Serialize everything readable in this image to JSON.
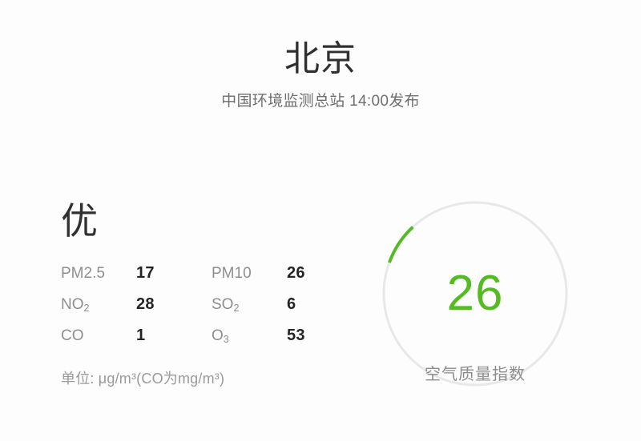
{
  "header": {
    "city": "北京",
    "source": "中国环境监测总站 14:00发布"
  },
  "air_quality": {
    "level_label": "优",
    "aqi_value": "26",
    "aqi_caption": "空气质量指数",
    "accent_color": "#55bb22",
    "track_color": "#e8e8e8"
  },
  "pollutants": {
    "rows": [
      {
        "left": {
          "label": "PM2.5",
          "sub": "",
          "value": "17"
        },
        "right": {
          "label": "PM10",
          "sub": "",
          "value": "26"
        }
      },
      {
        "left": {
          "label": "NO",
          "sub": "2",
          "value": "28"
        },
        "right": {
          "label": "SO",
          "sub": "2",
          "value": "6"
        }
      },
      {
        "left": {
          "label": "CO",
          "sub": "",
          "value": "1"
        },
        "right": {
          "label": "O",
          "sub": "3",
          "value": "53"
        }
      }
    ],
    "units_note": "单位: μg/m³(CO为mg/m³)"
  },
  "chart_data": {
    "type": "gauge",
    "title": "空气质量指数",
    "value": 26,
    "display_value": "26",
    "category_label": "优",
    "range": [
      0,
      350
    ],
    "arc_fraction": 0.075,
    "arc_start_deg": 200,
    "arc_end_deg": 227,
    "value_color": "#55bb22",
    "track_color": "#e8e8e8",
    "components": [
      {
        "name": "PM2.5",
        "value": 17,
        "unit": "μg/m³"
      },
      {
        "name": "PM10",
        "value": 26,
        "unit": "μg/m³"
      },
      {
        "name": "NO2",
        "value": 28,
        "unit": "μg/m³"
      },
      {
        "name": "SO2",
        "value": 6,
        "unit": "μg/m³"
      },
      {
        "name": "CO",
        "value": 1,
        "unit": "mg/m³"
      },
      {
        "name": "O3",
        "value": 53,
        "unit": "μg/m³"
      }
    ]
  }
}
